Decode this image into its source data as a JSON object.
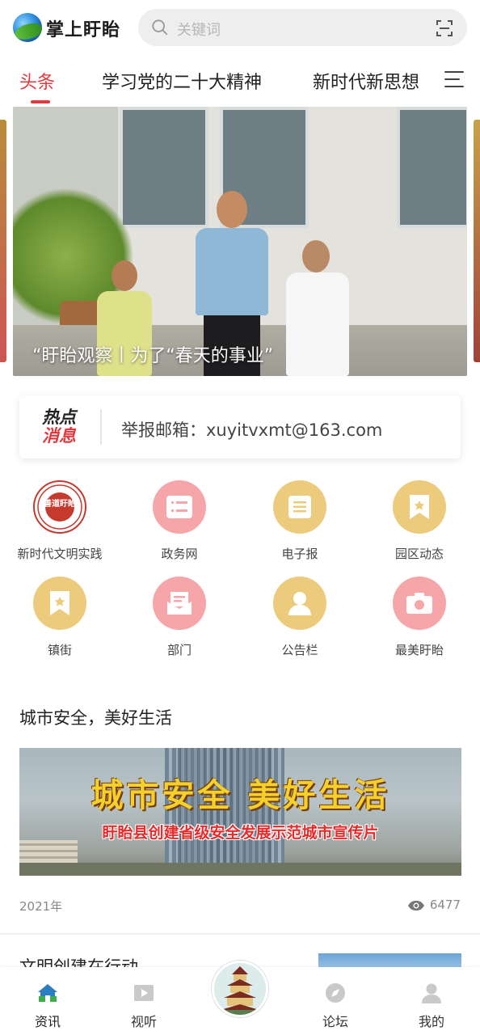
{
  "header": {
    "app_name": "掌上盱眙",
    "search_placeholder": "关键词"
  },
  "tabs": [
    {
      "label": "头条",
      "active": true
    },
    {
      "label": "学习党的二十大精神",
      "active": false
    },
    {
      "label": "新时代新思想",
      "active": false
    }
  ],
  "banner": {
    "caption": "“盱眙观察丨为了“春天的事业”"
  },
  "hot_news": {
    "logo_line1": "热点",
    "logo_line2": "消息",
    "text": "举报邮箱：xuyitvxmt@163.com"
  },
  "grid": [
    {
      "label": "新时代文明实践",
      "icon": "civilization-seal-icon",
      "seal_text": "善道盱眙"
    },
    {
      "label": "政务网",
      "icon": "list-icon"
    },
    {
      "label": "电子报",
      "icon": "newspaper-icon"
    },
    {
      "label": "园区动态",
      "icon": "bookmark-icon"
    },
    {
      "label": "镇街",
      "icon": "bookmark-icon"
    },
    {
      "label": "部门",
      "icon": "mail-icon"
    },
    {
      "label": "公告栏",
      "icon": "user-icon"
    },
    {
      "label": "最美盱眙",
      "icon": "camera-icon"
    }
  ],
  "section": {
    "title": "城市安全，美好生活",
    "video_title": "城市安全 美好生活",
    "video_subtitle": "盱眙县创建省级安全发展示范城市宣传片",
    "year": "2021年",
    "views": "6477"
  },
  "next_article": {
    "title": "文明创建在行动"
  },
  "bottom_nav": [
    {
      "label": "资讯",
      "icon": "home-icon",
      "active": true
    },
    {
      "label": "视听",
      "icon": "video-icon",
      "active": false
    },
    {
      "label": "",
      "icon": "pagoda-icon",
      "active": false
    },
    {
      "label": "论坛",
      "icon": "compass-icon",
      "active": false
    },
    {
      "label": "我的",
      "icon": "profile-icon",
      "active": false
    }
  ],
  "colors": {
    "accent": "#e0393e",
    "icon_pink": "#f6a5a9",
    "icon_yellow": "#eccb7c",
    "nav_active": "#2b7fc0"
  }
}
